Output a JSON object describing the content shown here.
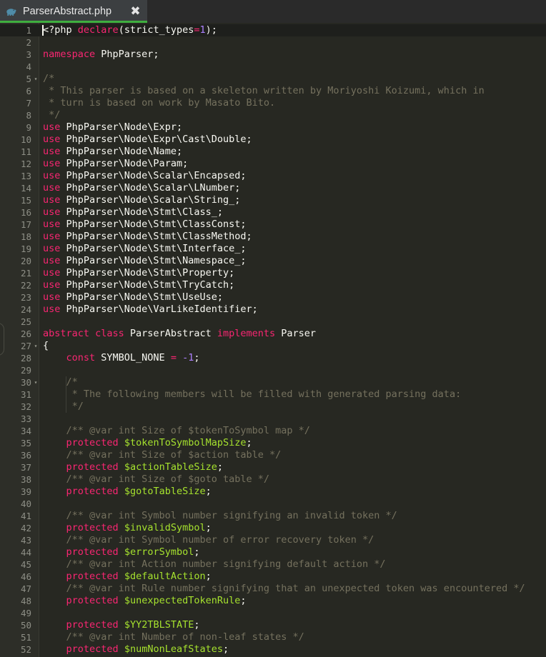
{
  "window": {
    "tab": {
      "icon": "php-elephant-icon",
      "title": "ParserAbstract.php",
      "close_label": "✖"
    }
  },
  "theme": {
    "editor_bg": "#272822",
    "gutter_bg": "#2d2e28",
    "tabbar_bg": "#2a2a2a",
    "tab_active_bg": "#3c3f41",
    "tab_underline": "#3fae3f",
    "keyword": "#f92672",
    "number": "#ae81ff",
    "variable": "#a6e22e",
    "comment": "#75715e",
    "text": "#f8f8f2",
    "line_number": "#8e8f86",
    "current_line_bg": "#1e1f1c"
  },
  "editor": {
    "language": "PHP",
    "first_line": 1,
    "last_line": 52,
    "cursor_line": 1,
    "cursor_column": 1,
    "fold_markers": [
      5,
      27,
      30
    ],
    "lines": [
      {
        "n": 1,
        "tokens": [
          {
            "t": "txt",
            "s": "<?php "
          },
          {
            "t": "kw",
            "s": "declare"
          },
          {
            "t": "txt",
            "s": "(strict_types"
          },
          {
            "t": "kw",
            "s": "="
          },
          {
            "t": "num",
            "s": "1"
          },
          {
            "t": "txt",
            "s": ");"
          }
        ]
      },
      {
        "n": 2,
        "tokens": []
      },
      {
        "n": 3,
        "tokens": [
          {
            "t": "kw",
            "s": "namespace"
          },
          {
            "t": "txt",
            "s": " PhpParser;"
          }
        ]
      },
      {
        "n": 4,
        "tokens": []
      },
      {
        "n": 5,
        "tokens": [
          {
            "t": "cmt",
            "s": "/*"
          }
        ]
      },
      {
        "n": 6,
        "tokens": [
          {
            "t": "cmt",
            "s": " * This parser is based on a skeleton written by Moriyoshi Koizumi, which in"
          }
        ]
      },
      {
        "n": 7,
        "tokens": [
          {
            "t": "cmt",
            "s": " * turn is based on work by Masato Bito."
          }
        ]
      },
      {
        "n": 8,
        "tokens": [
          {
            "t": "cmt",
            "s": " */"
          }
        ]
      },
      {
        "n": 9,
        "tokens": [
          {
            "t": "kw",
            "s": "use"
          },
          {
            "t": "txt",
            "s": " PhpParser\\Node\\Expr;"
          }
        ]
      },
      {
        "n": 10,
        "tokens": [
          {
            "t": "kw",
            "s": "use"
          },
          {
            "t": "txt",
            "s": " PhpParser\\Node\\Expr\\Cast\\Double;"
          }
        ]
      },
      {
        "n": 11,
        "tokens": [
          {
            "t": "kw",
            "s": "use"
          },
          {
            "t": "txt",
            "s": " PhpParser\\Node\\Name;"
          }
        ]
      },
      {
        "n": 12,
        "tokens": [
          {
            "t": "kw",
            "s": "use"
          },
          {
            "t": "txt",
            "s": " PhpParser\\Node\\Param;"
          }
        ]
      },
      {
        "n": 13,
        "tokens": [
          {
            "t": "kw",
            "s": "use"
          },
          {
            "t": "txt",
            "s": " PhpParser\\Node\\Scalar\\Encapsed;"
          }
        ]
      },
      {
        "n": 14,
        "tokens": [
          {
            "t": "kw",
            "s": "use"
          },
          {
            "t": "txt",
            "s": " PhpParser\\Node\\Scalar\\LNumber;"
          }
        ]
      },
      {
        "n": 15,
        "tokens": [
          {
            "t": "kw",
            "s": "use"
          },
          {
            "t": "txt",
            "s": " PhpParser\\Node\\Scalar\\String_;"
          }
        ]
      },
      {
        "n": 16,
        "tokens": [
          {
            "t": "kw",
            "s": "use"
          },
          {
            "t": "txt",
            "s": " PhpParser\\Node\\Stmt\\Class_;"
          }
        ]
      },
      {
        "n": 17,
        "tokens": [
          {
            "t": "kw",
            "s": "use"
          },
          {
            "t": "txt",
            "s": " PhpParser\\Node\\Stmt\\ClassConst;"
          }
        ]
      },
      {
        "n": 18,
        "tokens": [
          {
            "t": "kw",
            "s": "use"
          },
          {
            "t": "txt",
            "s": " PhpParser\\Node\\Stmt\\ClassMethod;"
          }
        ]
      },
      {
        "n": 19,
        "tokens": [
          {
            "t": "kw",
            "s": "use"
          },
          {
            "t": "txt",
            "s": " PhpParser\\Node\\Stmt\\Interface_;"
          }
        ]
      },
      {
        "n": 20,
        "tokens": [
          {
            "t": "kw",
            "s": "use"
          },
          {
            "t": "txt",
            "s": " PhpParser\\Node\\Stmt\\Namespace_;"
          }
        ]
      },
      {
        "n": 21,
        "tokens": [
          {
            "t": "kw",
            "s": "use"
          },
          {
            "t": "txt",
            "s": " PhpParser\\Node\\Stmt\\Property;"
          }
        ]
      },
      {
        "n": 22,
        "tokens": [
          {
            "t": "kw",
            "s": "use"
          },
          {
            "t": "txt",
            "s": " PhpParser\\Node\\Stmt\\TryCatch;"
          }
        ]
      },
      {
        "n": 23,
        "tokens": [
          {
            "t": "kw",
            "s": "use"
          },
          {
            "t": "txt",
            "s": " PhpParser\\Node\\Stmt\\UseUse;"
          }
        ]
      },
      {
        "n": 24,
        "tokens": [
          {
            "t": "kw",
            "s": "use"
          },
          {
            "t": "txt",
            "s": " PhpParser\\Node\\VarLikeIdentifier;"
          }
        ]
      },
      {
        "n": 25,
        "tokens": []
      },
      {
        "n": 26,
        "tokens": [
          {
            "t": "kw",
            "s": "abstract class"
          },
          {
            "t": "txt",
            "s": " ParserAbstract "
          },
          {
            "t": "kw",
            "s": "implements"
          },
          {
            "t": "txt",
            "s": " Parser"
          }
        ]
      },
      {
        "n": 27,
        "tokens": [
          {
            "t": "txt",
            "s": "{"
          }
        ]
      },
      {
        "n": 28,
        "tokens": [
          {
            "t": "txt",
            "s": "    "
          },
          {
            "t": "kw",
            "s": "const"
          },
          {
            "t": "txt",
            "s": " SYMBOL_NONE "
          },
          {
            "t": "kw",
            "s": "="
          },
          {
            "t": "txt",
            "s": " "
          },
          {
            "t": "num",
            "s": "-1"
          },
          {
            "t": "txt",
            "s": ";"
          }
        ]
      },
      {
        "n": 29,
        "tokens": []
      },
      {
        "n": 30,
        "tokens": [
          {
            "t": "cmt",
            "s": "    /*"
          }
        ]
      },
      {
        "n": 31,
        "tokens": [
          {
            "t": "cmt",
            "s": "     * The following members will be filled with generated parsing data:"
          }
        ]
      },
      {
        "n": 32,
        "tokens": [
          {
            "t": "cmt",
            "s": "     */"
          }
        ]
      },
      {
        "n": 33,
        "tokens": []
      },
      {
        "n": 34,
        "tokens": [
          {
            "t": "cmt",
            "s": "    /** @var int Size of $tokenToSymbol map */"
          }
        ]
      },
      {
        "n": 35,
        "tokens": [
          {
            "t": "txt",
            "s": "    "
          },
          {
            "t": "kw",
            "s": "protected"
          },
          {
            "t": "txt",
            "s": " "
          },
          {
            "t": "var",
            "s": "$tokenToSymbolMapSize"
          },
          {
            "t": "txt",
            "s": ";"
          }
        ]
      },
      {
        "n": 36,
        "tokens": [
          {
            "t": "cmt",
            "s": "    /** @var int Size of $action table */"
          }
        ]
      },
      {
        "n": 37,
        "tokens": [
          {
            "t": "txt",
            "s": "    "
          },
          {
            "t": "kw",
            "s": "protected"
          },
          {
            "t": "txt",
            "s": " "
          },
          {
            "t": "var",
            "s": "$actionTableSize"
          },
          {
            "t": "txt",
            "s": ";"
          }
        ]
      },
      {
        "n": 38,
        "tokens": [
          {
            "t": "cmt",
            "s": "    /** @var int Size of $goto table */"
          }
        ]
      },
      {
        "n": 39,
        "tokens": [
          {
            "t": "txt",
            "s": "    "
          },
          {
            "t": "kw",
            "s": "protected"
          },
          {
            "t": "txt",
            "s": " "
          },
          {
            "t": "var",
            "s": "$gotoTableSize"
          },
          {
            "t": "txt",
            "s": ";"
          }
        ]
      },
      {
        "n": 40,
        "tokens": []
      },
      {
        "n": 41,
        "tokens": [
          {
            "t": "cmt",
            "s": "    /** @var int Symbol number signifying an invalid token */"
          }
        ]
      },
      {
        "n": 42,
        "tokens": [
          {
            "t": "txt",
            "s": "    "
          },
          {
            "t": "kw",
            "s": "protected"
          },
          {
            "t": "txt",
            "s": " "
          },
          {
            "t": "var",
            "s": "$invalidSymbol"
          },
          {
            "t": "txt",
            "s": ";"
          }
        ]
      },
      {
        "n": 43,
        "tokens": [
          {
            "t": "cmt",
            "s": "    /** @var int Symbol number of error recovery token */"
          }
        ]
      },
      {
        "n": 44,
        "tokens": [
          {
            "t": "txt",
            "s": "    "
          },
          {
            "t": "kw",
            "s": "protected"
          },
          {
            "t": "txt",
            "s": " "
          },
          {
            "t": "var",
            "s": "$errorSymbol"
          },
          {
            "t": "txt",
            "s": ";"
          }
        ]
      },
      {
        "n": 45,
        "tokens": [
          {
            "t": "cmt",
            "s": "    /** @var int Action number signifying default action */"
          }
        ]
      },
      {
        "n": 46,
        "tokens": [
          {
            "t": "txt",
            "s": "    "
          },
          {
            "t": "kw",
            "s": "protected"
          },
          {
            "t": "txt",
            "s": " "
          },
          {
            "t": "var",
            "s": "$defaultAction"
          },
          {
            "t": "txt",
            "s": ";"
          }
        ]
      },
      {
        "n": 47,
        "tokens": [
          {
            "t": "cmt",
            "s": "    /** @var int Rule number signifying that an unexpected token was encountered */"
          }
        ]
      },
      {
        "n": 48,
        "tokens": [
          {
            "t": "txt",
            "s": "    "
          },
          {
            "t": "kw",
            "s": "protected"
          },
          {
            "t": "txt",
            "s": " "
          },
          {
            "t": "var",
            "s": "$unexpectedTokenRule"
          },
          {
            "t": "txt",
            "s": ";"
          }
        ]
      },
      {
        "n": 49,
        "tokens": []
      },
      {
        "n": 50,
        "tokens": [
          {
            "t": "txt",
            "s": "    "
          },
          {
            "t": "kw",
            "s": "protected"
          },
          {
            "t": "txt",
            "s": " "
          },
          {
            "t": "var",
            "s": "$YY2TBLSTATE"
          },
          {
            "t": "txt",
            "s": ";"
          }
        ]
      },
      {
        "n": 51,
        "tokens": [
          {
            "t": "cmt",
            "s": "    /** @var int Number of non-leaf states */"
          }
        ]
      },
      {
        "n": 52,
        "tokens": [
          {
            "t": "txt",
            "s": "    "
          },
          {
            "t": "kw",
            "s": "protected"
          },
          {
            "t": "txt",
            "s": " "
          },
          {
            "t": "var",
            "s": "$numNonLeafStates"
          },
          {
            "t": "txt",
            "s": ";"
          }
        ]
      }
    ]
  }
}
